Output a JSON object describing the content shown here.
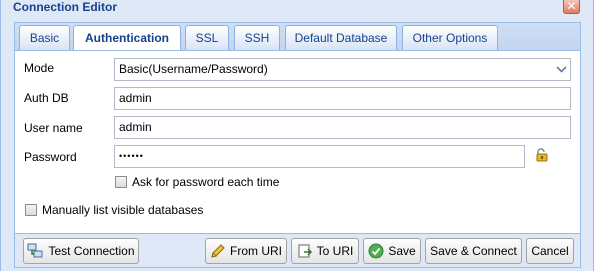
{
  "window": {
    "title": "Connection Editor",
    "close_glyph": "✕"
  },
  "tabs": [
    {
      "label": "Basic",
      "active": false
    },
    {
      "label": "Authentication",
      "active": true
    },
    {
      "label": "SSL",
      "active": false
    },
    {
      "label": "SSH",
      "active": false
    },
    {
      "label": "Default Database",
      "active": false
    },
    {
      "label": "Other Options",
      "active": false
    }
  ],
  "form": {
    "mode": {
      "label": "Mode",
      "value": "Basic(Username/Password)"
    },
    "auth_db": {
      "label": "Auth DB",
      "value": "admin"
    },
    "username": {
      "label": "User name",
      "value": "admin"
    },
    "password": {
      "label": "Password",
      "value": "••••••"
    },
    "ask_password": {
      "label": "Ask for password each time",
      "checked": false
    },
    "manual_dbs": {
      "label": "Manually list visible databases",
      "checked": false
    }
  },
  "buttons": {
    "test": "Test Connection",
    "from_uri": "From URI",
    "to_uri": "To URI",
    "save": "Save",
    "save_connect": "Save & Connect",
    "cancel": "Cancel"
  },
  "icons": {
    "combo": "chevron-down-icon",
    "lock": "lock-icon",
    "test": "network-computers-icon",
    "from_uri": "pencil-icon",
    "to_uri": "export-icon",
    "save": "check-circle-icon"
  },
  "colors": {
    "accent": "#15428b",
    "border": "#99bbe8",
    "background": "#dfe8f6"
  }
}
